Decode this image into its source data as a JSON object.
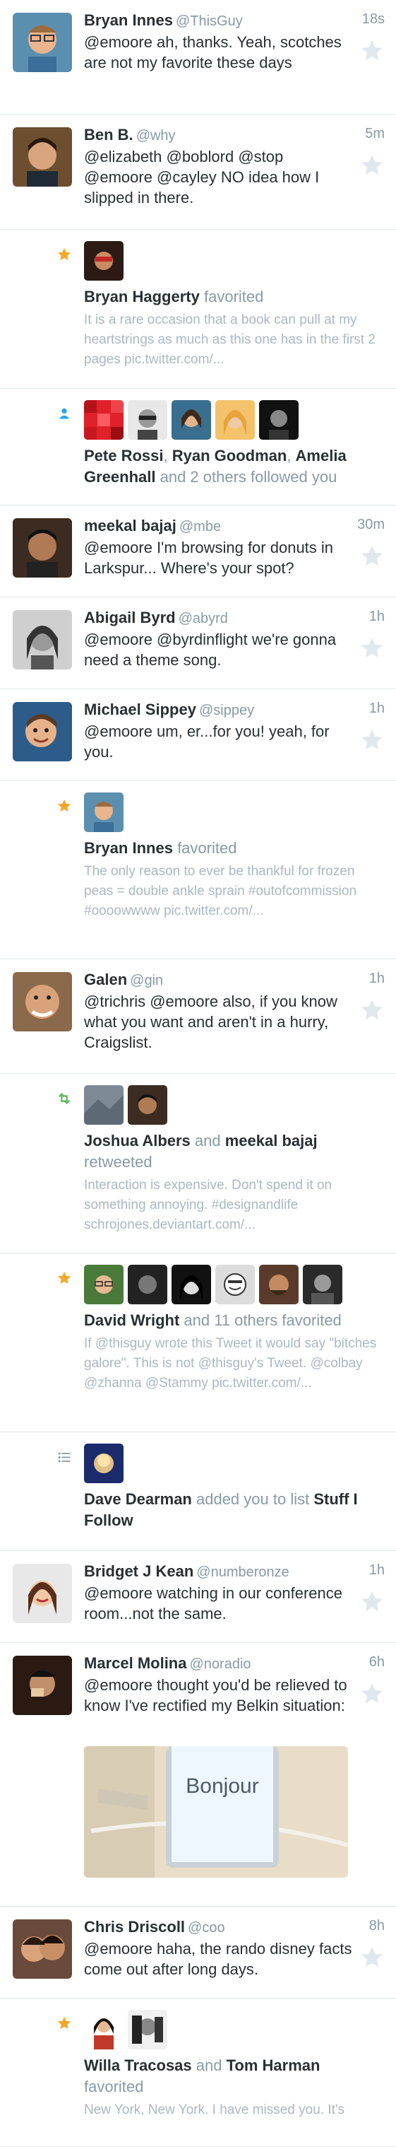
{
  "colors": {
    "accent_star": "#f5a623",
    "retweet": "#5cb85c",
    "follow": "#2aa3ef",
    "muted": "#8899a6"
  },
  "feed": {
    "t1": {
      "name": "Bryan Innes",
      "handle": "@ThisGuy",
      "time": "18s",
      "text": "@emoore ah, thanks. Yeah, scotches are not my favorite these days"
    },
    "t2": {
      "name": "Ben B.",
      "handle": "@why",
      "time": "5m",
      "text": "@elizabeth @boblord @stop @emoore @cayley NO idea how I slipped in there."
    },
    "a1": {
      "icon": "star-icon",
      "name": "Bryan Haggerty",
      "action": "favorited",
      "sub": "It is a rare occasion that a book can pull at my heartstrings as much as this one has in the first 2 pages pic.twitter.com/..."
    },
    "a2": {
      "icon": "follow-icon",
      "n1": "Pete Rossi",
      "sep1": ", ",
      "n2": "Ryan Goodman",
      "sep2": ", ",
      "n3": "Amelia Greenhall",
      "rest": " and 2 others followed you"
    },
    "t3": {
      "name": "meekal bajaj",
      "handle": "@mbe",
      "time": "30m",
      "text": "@emoore I'm browsing for donuts in Larkspur... Where's your spot?"
    },
    "t4": {
      "name": "Abigail Byrd",
      "handle": "@abyrd",
      "time": "1h",
      "text": "@emoore @byrdinflight we're gonna need a theme song."
    },
    "t5": {
      "name": "Michael Sippey",
      "handle": "@sippey",
      "time": "1h",
      "text": "@emoore um, er...for you! yeah, for you."
    },
    "a3": {
      "icon": "star-icon",
      "name": "Bryan Innes",
      "action": "favorited",
      "sub": "The only reason to ever be thankful for frozen peas = double ankle sprain #outofcommission #oooowwww pic.twitter.com/..."
    },
    "t6": {
      "name": "Galen",
      "handle": "@gin",
      "time": "1h",
      "text": "@trichris @emoore also, if you know what you want and aren't in a hurry, Craigslist."
    },
    "a4": {
      "icon": "retweet-icon",
      "n1": "Joshua Albers",
      "and": " and ",
      "n2": "meekal bajaj",
      "action": "retweeted",
      "sub": "Interaction is expensive. Don't spend it on something annoying. #designandlife schrojones.deviantart.com/..."
    },
    "a5": {
      "icon": "star-icon",
      "name": "David Wright",
      "action": " and 11 others favorited",
      "sub": "If @thisguy wrote this Tweet it would say \"bitches galore\". This is not @thisguy's Tweet. @colbay @zhanna @Stammy pic.twitter.com/..."
    },
    "a6": {
      "icon": "list-icon",
      "name": "Dave Dearman",
      "action": " added you to list ",
      "list": "Stuff I Follow"
    },
    "t7": {
      "name": "Bridget J Kean",
      "handle": "@numberonze",
      "time": "1h",
      "text": "@emoore watching in our conference room...not the same."
    },
    "t8": {
      "name": "Marcel Molina",
      "handle": "@noradio",
      "time": "6h",
      "text": "@emoore thought you'd be relieved to know I've rectified my Belkin situation:",
      "photo_text": "Bonjour"
    },
    "t9": {
      "name": "Chris Driscoll",
      "handle": "@coo",
      "time": "8h",
      "text": "@emoore haha, the rando disney facts come out after long days."
    },
    "a7": {
      "icon": "star-icon",
      "n1": "Willa Tracosas",
      "and": " and ",
      "n2": "Tom Harman",
      "action": "favorited",
      "sub": "New York, New York. I have missed you. It's"
    }
  }
}
